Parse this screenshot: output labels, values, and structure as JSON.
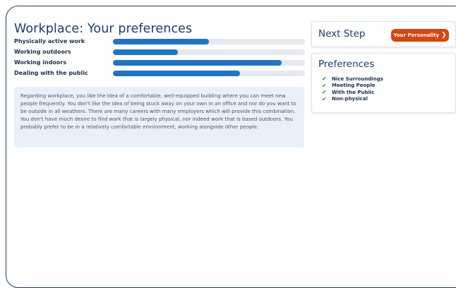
{
  "workplace": {
    "title": "Workplace: Your preferences",
    "bars": [
      {
        "label": "Physically active work",
        "value": 0.5
      },
      {
        "label": "Working outdoors",
        "value": 0.34
      },
      {
        "label": "Working indoors",
        "value": 0.88
      },
      {
        "label": "Dealing with the public",
        "value": 0.66
      }
    ],
    "description": "Regarding workplace, you like the idea of a comfortable, well-equipped building where you can meet new people frequently. You don't like the idea of being stuck away on your own in an office and nor do you want to be outside in all weathers. There are many careers with many employers which will provide this combination. You don't have much desire to find work that is largely physical, nor indeed work that is based outdoors. You probably prefer to be in a relatively comfortable environment, working alongside other people."
  },
  "next_step": {
    "title": "Next Step",
    "button_label": "Your Personality",
    "button_icon": "chevron-right-icon",
    "button_color": "#d9440f"
  },
  "preferences": {
    "title": "Preferences",
    "check_icon": "check-icon",
    "check_color": "#2e8b3c",
    "items": [
      "Nice Surroundings",
      "Meeting People",
      "With the Public",
      "Non-physical"
    ]
  },
  "colors": {
    "accent": "#1f74c8",
    "heading": "#1e3a6e",
    "description_bg": "#e8f1fa"
  }
}
